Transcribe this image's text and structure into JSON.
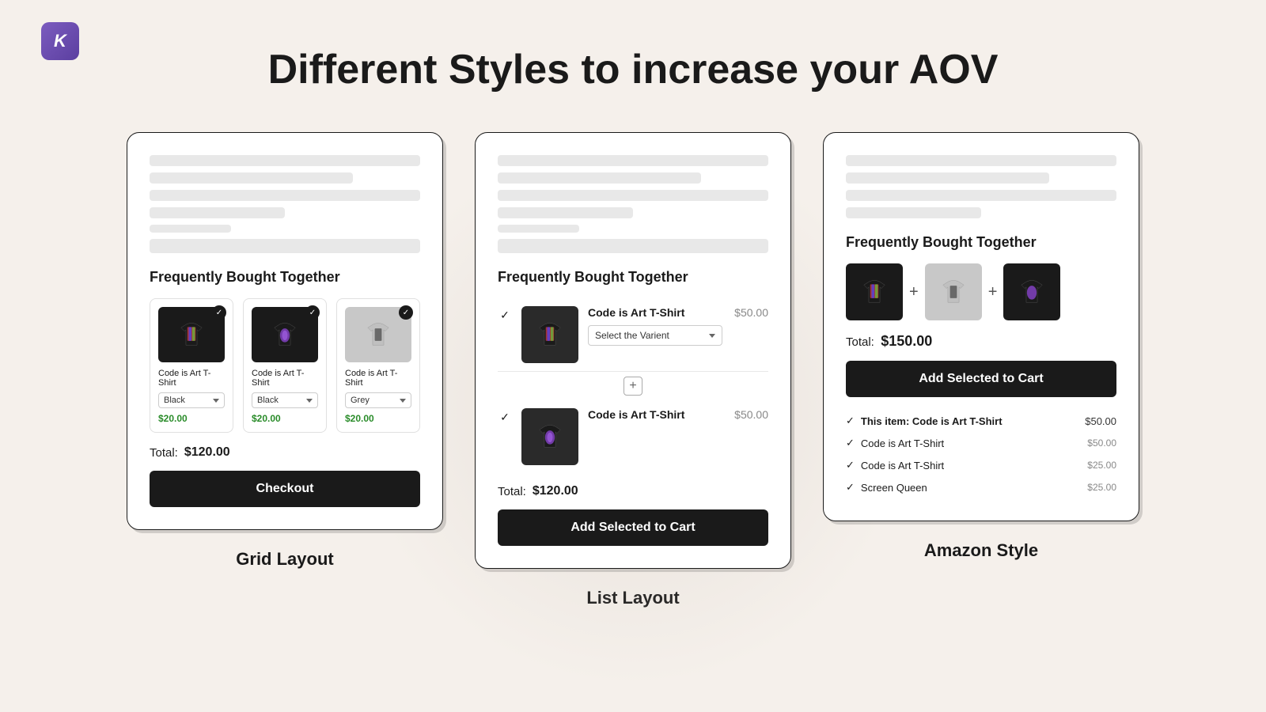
{
  "logo": {
    "letter": "K"
  },
  "page": {
    "title": "Different Styles to increase your AOV"
  },
  "grid_layout": {
    "label": "Grid Layout",
    "section_title": "Frequently Bought Together",
    "products": [
      {
        "name": "Code is Art T-Shirt",
        "variant": "Black",
        "price": "$20.00",
        "img_type": "dark_colorful"
      },
      {
        "name": "Code is Art T-Shirt",
        "variant": "Black",
        "price": "$20.00",
        "img_type": "dark_purple"
      },
      {
        "name": "Code is Art T-Shirt",
        "variant": "Grey",
        "price": "$20.00",
        "img_type": "light_dark"
      }
    ],
    "total_label": "Total:",
    "total_amount": "$120.00",
    "button_label": "Checkout"
  },
  "list_layout": {
    "label": "List Layout",
    "section_title": "Frequently Bought Together",
    "products": [
      {
        "name": "Code is Art T-Shirt",
        "price": "$50.00",
        "variant_placeholder": "Select the Varient",
        "img_type": "dark_colorful"
      },
      {
        "name": "Code is Art T-Shirt",
        "price": "$50.00",
        "img_type": "dark_purple"
      }
    ],
    "total_label": "Total:",
    "total_amount": "$120.00",
    "button_label": "Add Selected  to Cart"
  },
  "amazon_style": {
    "label": "Amazon Style",
    "section_title": "Frequently Bought Together",
    "products": [
      {
        "img_type": "dark_colorful"
      },
      {
        "img_type": "light_dark"
      },
      {
        "img_type": "dark_purple"
      }
    ],
    "total_label": "Total:",
    "total_amount": "$150.00",
    "button_label": "Add Selected to Cart",
    "items": [
      {
        "name": "This item: Code is Art T-Shirt",
        "price": "$50.00",
        "bold": true
      },
      {
        "name": "Code is Art T-Shirt",
        "price": "$50.00",
        "bold": false
      },
      {
        "name": "Code is Art T-Shirt",
        "price": "$25.00",
        "bold": false
      },
      {
        "name": "Screen Queen",
        "price": "$25.00",
        "bold": false
      }
    ]
  }
}
